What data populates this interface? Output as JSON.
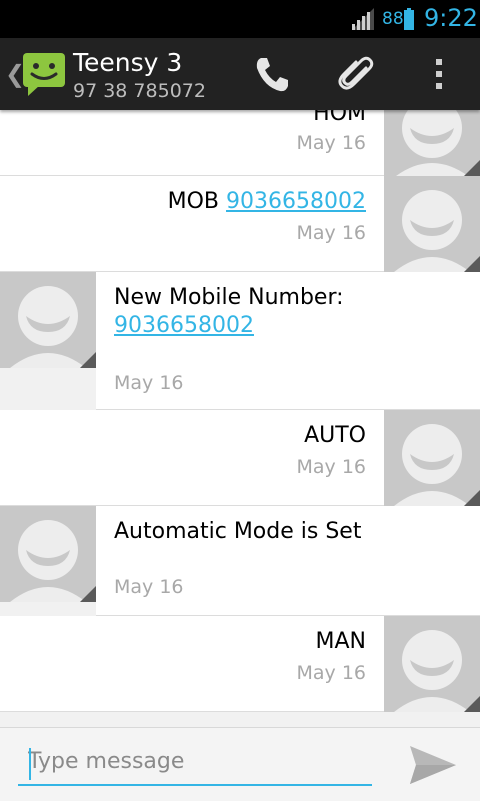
{
  "status_bar": {
    "battery_percent": "88",
    "time": "9:22",
    "accent_color": "#33b5e5"
  },
  "header": {
    "contact_name": "Teensy 3",
    "contact_number": "97 38 785072",
    "icons": [
      "messaging-app-icon",
      "phone-icon",
      "paperclip-icon",
      "overflow-menu-icon"
    ]
  },
  "messages": [
    {
      "direction": "sent",
      "text_prefix": "HOM",
      "link": "",
      "date": "May 16"
    },
    {
      "direction": "sent",
      "text_prefix": "MOB ",
      "link": "9036658002",
      "date": "May 16"
    },
    {
      "direction": "received",
      "text_prefix": "New Mobile Number:",
      "link": "9036658002",
      "date": "May 16"
    },
    {
      "direction": "sent",
      "text_prefix": "AUTO",
      "link": "",
      "date": "May 16"
    },
    {
      "direction": "received",
      "text_prefix": "Automatic Mode is Set",
      "link": "",
      "date": "May 16"
    },
    {
      "direction": "sent",
      "text_prefix": "MAN",
      "link": "",
      "date": "May 16"
    }
  ],
  "composer": {
    "placeholder": "Type message",
    "value": ""
  }
}
